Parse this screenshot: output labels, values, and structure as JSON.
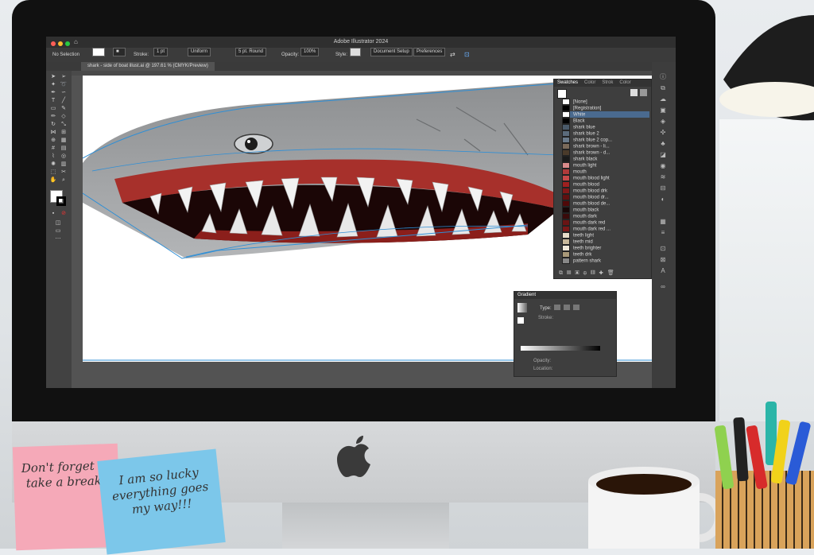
{
  "app": {
    "window_title": "Adobe Illustrator 2024",
    "document_tab": "shark - side of boat illust.ai @ 197.61 % (CMYK/Preview)"
  },
  "control_bar": {
    "selection": "No Selection",
    "stroke_label": "Stroke:",
    "stroke_weight": "1 pt",
    "stroke_profile": "Uniform",
    "brush": "5 pt. Round",
    "opacity_label": "Opacity:",
    "opacity_value": "100%",
    "style_label": "Style:",
    "document_setup": "Document Setup",
    "preferences": "Preferences"
  },
  "swatches_panel": {
    "tabs": [
      "Swatches",
      "Color",
      "Strok",
      "Color"
    ],
    "items": [
      {
        "name": "[None]",
        "color": "#ffffff"
      },
      {
        "name": "[Registration]",
        "color": "#000000"
      },
      {
        "name": "White",
        "color": "#ffffff",
        "selected": true
      },
      {
        "name": "Black",
        "color": "#000000"
      },
      {
        "name": "shark blue",
        "color": "#4a5a6a"
      },
      {
        "name": "shark blue 2",
        "color": "#5b6b7b"
      },
      {
        "name": "shark blue 2 cop...",
        "color": "#6a7a8a"
      },
      {
        "name": "shark brown - li...",
        "color": "#7a6a5a"
      },
      {
        "name": "shark brown - d...",
        "color": "#4a3a2a"
      },
      {
        "name": "shark black",
        "color": "#1a1a1a"
      },
      {
        "name": "mouth light",
        "color": "#d98a8a"
      },
      {
        "name": "mouth",
        "color": "#b03a3a"
      },
      {
        "name": "mouth blood light",
        "color": "#c84a4a"
      },
      {
        "name": "mouth blood",
        "color": "#a02020"
      },
      {
        "name": "mouth blood drk",
        "color": "#801818"
      },
      {
        "name": "mouth blood dr...",
        "color": "#601010"
      },
      {
        "name": "mouth blood de...",
        "color": "#500808"
      },
      {
        "name": "mouth black",
        "color": "#180606"
      },
      {
        "name": "mouth dark",
        "color": "#3a0a0a"
      },
      {
        "name": "mouth dark red",
        "color": "#6a1414"
      },
      {
        "name": "mouth dark red ...",
        "color": "#7a1818"
      },
      {
        "name": "teeth light",
        "color": "#e6dcc8"
      },
      {
        "name": "teeth mid",
        "color": "#c8b89a"
      },
      {
        "name": "teeth brighter",
        "color": "#f0e8d8"
      },
      {
        "name": "teeth drk",
        "color": "#a89878"
      },
      {
        "name": "pattern shark",
        "color": "#888888"
      }
    ]
  },
  "gradient_panel": {
    "title": "Gradient",
    "type_label": "Type:",
    "stroke_label": "Stroke:",
    "opacity_label": "Opacity:",
    "location_label": "Location:"
  },
  "sticky_notes": {
    "pink": "Don't forget to take a break!",
    "blue": "I am so lucky everything goes my way!!!"
  },
  "colors": {
    "ui_dark": "#535353",
    "panel": "#3e3e3e",
    "selection_blue": "#2f8fd6",
    "note_pink": "#f5a9b8",
    "note_blue": "#7cc7ea"
  }
}
